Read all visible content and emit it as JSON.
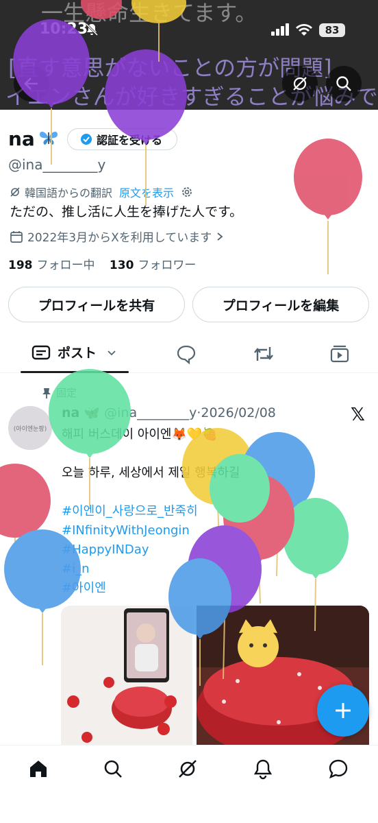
{
  "banner": {
    "line1": "一生懸命生きてます。",
    "line2": "[直す意思がないことの方が問題]",
    "line3": "イエンさんが好きすぎることが悩みで"
  },
  "status_bar": {
    "time": "10:23",
    "battery": "83"
  },
  "profile": {
    "name": "na",
    "verify_label": "認証を受ける",
    "handle": "@ina________y",
    "translated_from": "韓国語からの翻訳",
    "show_original": "原文を表示",
    "bio": "ただの、推し活に人生を捧げた人です。",
    "joined": "2022年3月からXを利用しています",
    "following_count": "198",
    "following_label": "フォロー中",
    "followers_count": "130",
    "followers_label": "フォロワー",
    "share_button": "プロフィールを共有",
    "edit_button": "プロフィールを編集"
  },
  "tabs": {
    "posts_label": "ポスト"
  },
  "pinned_post": {
    "pinned_label": "固定",
    "avatar_text": "(아이엔눈팡)",
    "author_name": "na",
    "author_handle": "@ina________y",
    "date": "·2026/02/08",
    "lines": [
      "해피 버스데이 아이엔🦊💛🍓",
      "",
      "오늘 하루, 세상에서 제일 행복하길",
      "",
      "#이엔이_사랑으로_반죽히",
      "#INfinityWithJeongin",
      "#HappyINDay",
      "#i_n",
      "#아이엔"
    ]
  },
  "colors": {
    "accent": "#1d9bf0",
    "balloon_purple": "#8a3fd6",
    "balloon_blue": "#4d9be8",
    "balloon_green": "#5ee0a0",
    "balloon_red": "#e0506a",
    "balloon_yellow": "#f2cc3a"
  }
}
